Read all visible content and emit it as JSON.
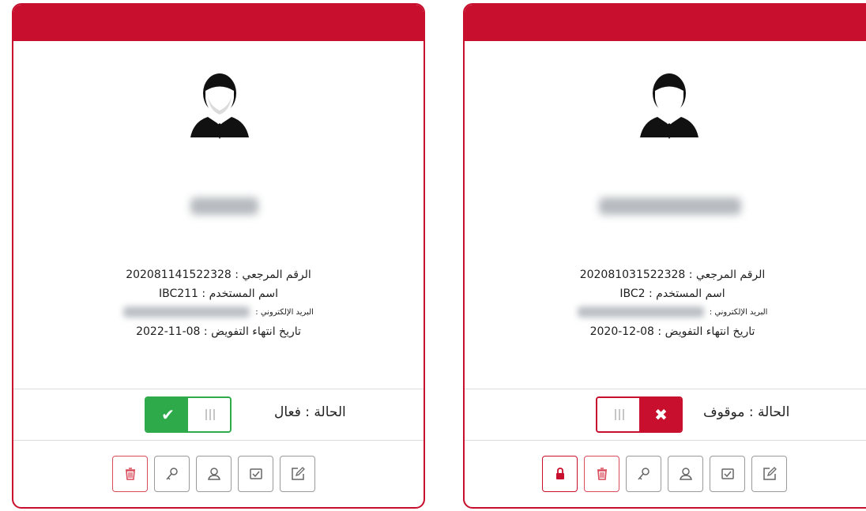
{
  "colors": {
    "accent": "#c8102e",
    "active": "#2eaa4a"
  },
  "cards": [
    {
      "reference_label": "الرقم المرجعي :",
      "reference_value": "202081141522328",
      "username_label": "اسم المستخدم :",
      "username_value": "IBC211",
      "email_label": "البريد الإلكتروني :",
      "expiry_label": "تاريخ انتهاء التفويض :",
      "expiry_value": "2022-11-08",
      "status_label": "الحالة : فعال",
      "status_active": true,
      "toggle_icon": "check-icon",
      "actions": [
        "trash-icon",
        "key-icon",
        "user-icon",
        "checkbox-icon",
        "edit-icon"
      ]
    },
    {
      "reference_label": "الرقم المرجعي :",
      "reference_value": "202081031522328",
      "username_label": "اسم المستخدم :",
      "username_value": "IBC2",
      "email_label": "البريد الإلكتروني :",
      "expiry_label": "تاريخ انتهاء التفويض :",
      "expiry_value": "2020-12-08",
      "status_label": "الحالة : موقوف",
      "status_active": false,
      "toggle_icon": "close-icon",
      "actions": [
        "lock-icon",
        "trash-icon",
        "key-icon",
        "user-icon",
        "checkbox-icon",
        "edit-icon"
      ]
    }
  ]
}
